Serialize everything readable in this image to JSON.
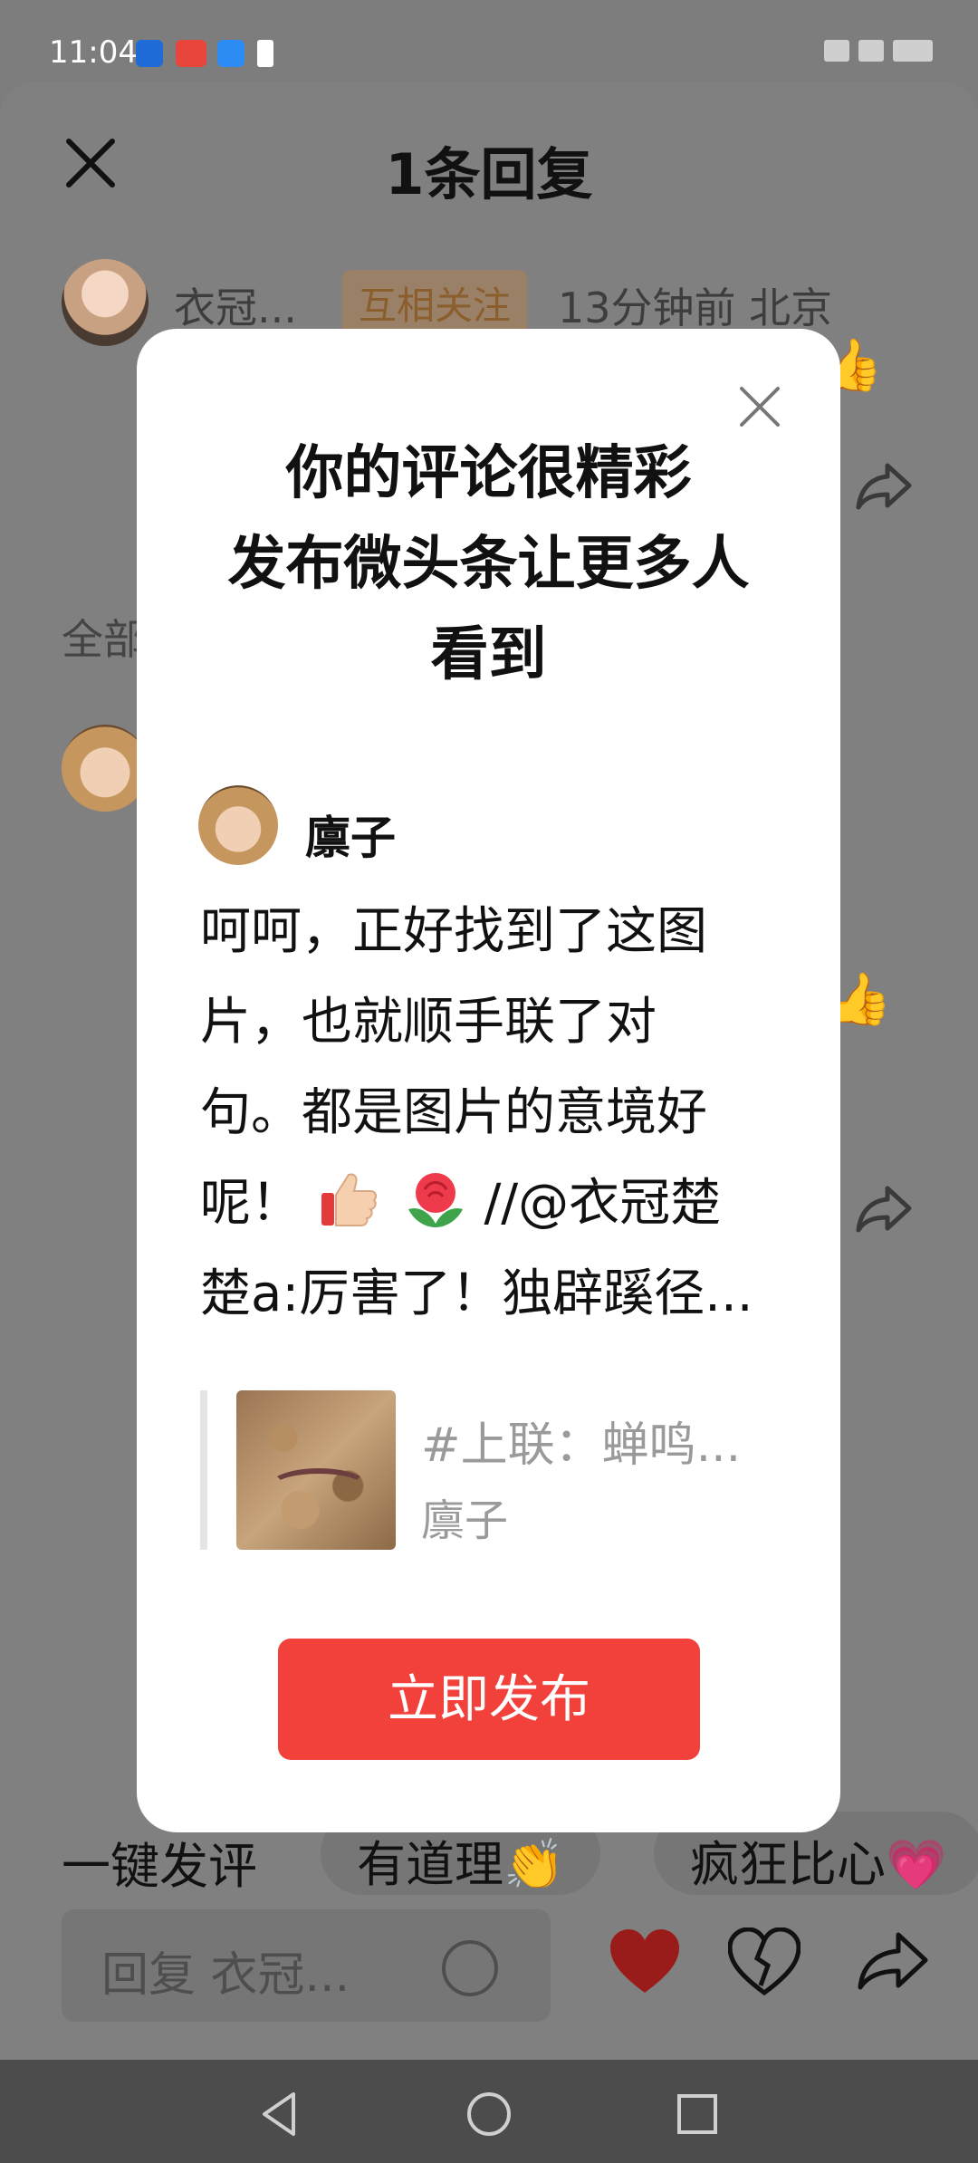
{
  "status_bar": {
    "time": "11:04"
  },
  "header": {
    "title": "1条回复"
  },
  "comment": {
    "author": "衣冠...",
    "mutual_tag": "互相关注",
    "meta": "13分钟前  北京"
  },
  "background": {
    "all_comments_label": "全部"
  },
  "modal": {
    "headline": [
      "你的评论很精彩",
      "发布微头条让更多人",
      "看到"
    ],
    "author_name": "廪子",
    "body_lines": [
      "呵呵，正好找到了这图",
      "片，也就顺手联了对",
      "句。都是图片的意境好",
      "呢！",
      "楚a:厉害了！独辟蹊径..."
    ],
    "body_line4_tail": "//@衣冠楚",
    "quote_title": "#上联：蝉鸣...",
    "quote_author": "廪子",
    "publish_label": "立即发布"
  },
  "quick_replies": {
    "label": "一键发评",
    "chips": [
      "有道理👏",
      "疯狂比心💗"
    ]
  },
  "input_bar": {
    "placeholder": "回复 衣冠..."
  },
  "colors": {
    "accent": "#f2413b",
    "overlay": "#808080"
  },
  "icons": [
    "close-icon",
    "share-icon",
    "emoji-icon",
    "heart-filled-icon",
    "heart-broken-icon",
    "back-icon",
    "home-icon",
    "recents-icon"
  ]
}
